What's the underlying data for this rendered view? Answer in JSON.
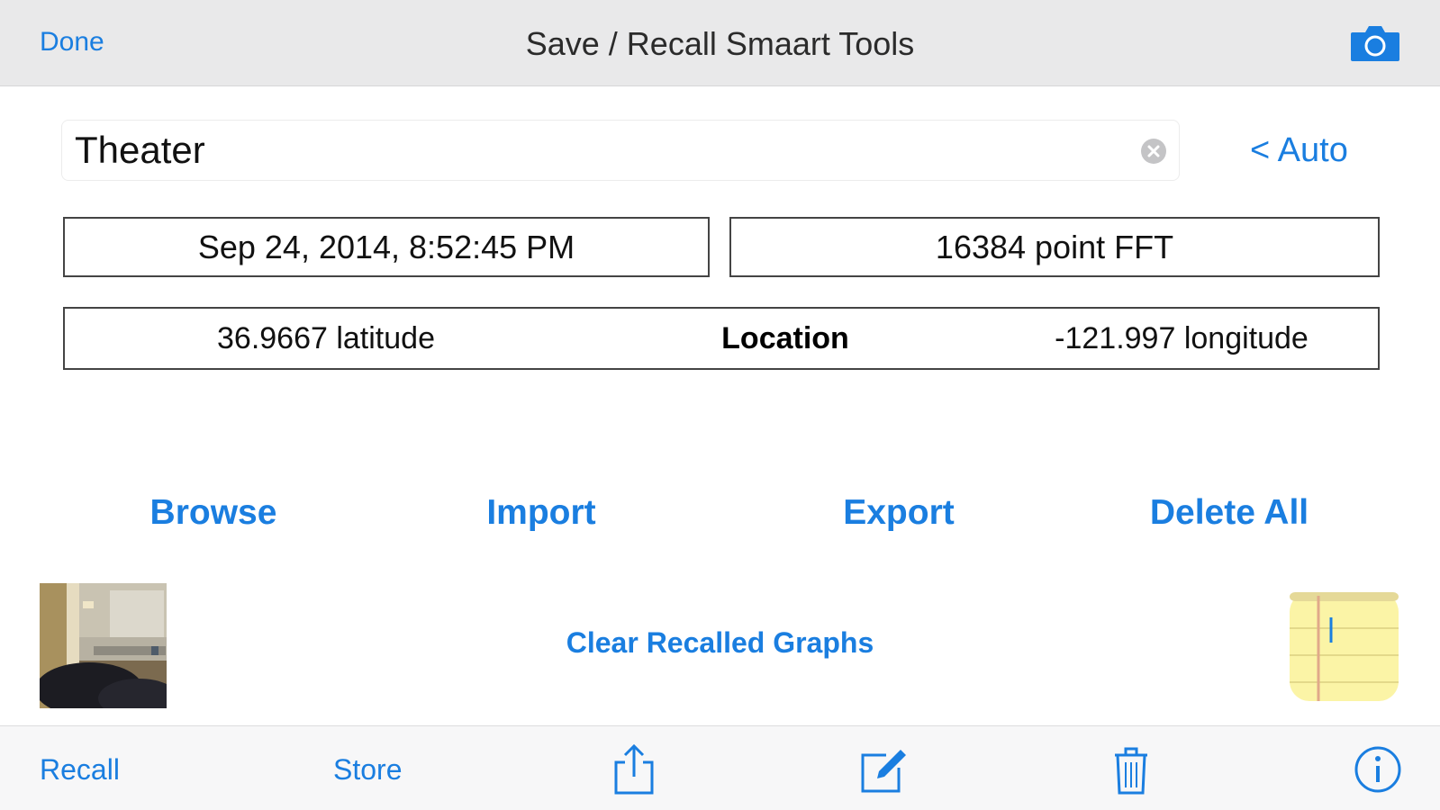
{
  "colors": {
    "accent": "#1a7ee0",
    "navbar_bg": "#e9e9ea",
    "toolbar_bg": "#f7f7f8",
    "box_border": "#444444"
  },
  "navbar": {
    "done_label": "Done",
    "title": "Save / Recall Smaart Tools",
    "camera_icon": "camera-icon"
  },
  "name_field": {
    "value": "Theater",
    "clear_icon": "clear-icon"
  },
  "auto_button": "< Auto",
  "info": {
    "timestamp": "Sep 24, 2014, 8:52:45 PM",
    "fft": "16384 point FFT",
    "latitude": "36.9667 latitude",
    "location_label": "Location",
    "longitude": "-121.997 longitude"
  },
  "actions": {
    "browse": "Browse",
    "import": "Import",
    "export": "Export",
    "delete_all": "Delete All"
  },
  "clear_graphs": "Clear Recalled Graphs",
  "toolbar": {
    "recall": "Recall",
    "store": "Store",
    "icons": [
      "share-icon",
      "compose-icon",
      "trash-icon",
      "info-icon"
    ]
  }
}
